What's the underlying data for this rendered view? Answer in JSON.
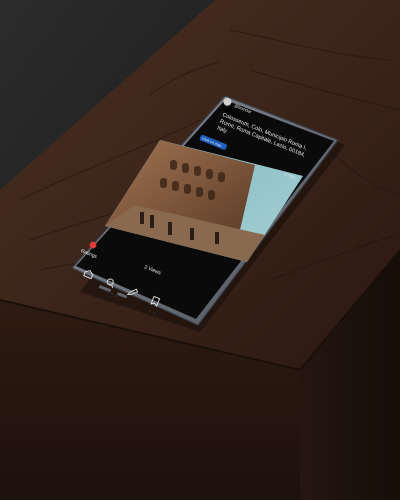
{
  "app": {
    "status_bar": {
      "carrier": ""
    },
    "header": {
      "username": "@brandar",
      "title_line1": "Colosseum, Colo, Municipio Roma I,",
      "title_line2": "Rome, Roma Capitale, Lazio, 00184,",
      "title_line3": "Italy",
      "chip_label": "View on map"
    },
    "photo": {
      "caption": "4 / GN"
    },
    "bottom_bar": {
      "ratings_label": "Ratings",
      "views_label": "2 Views",
      "nav": [
        "home-icon",
        "search-icon",
        "edit-icon",
        "bookmark-icon"
      ]
    },
    "colors": {
      "table_wood": "#3a2418",
      "phone_frame": "#6e737d",
      "screen_bg": "#0a0a0a",
      "accent_red": "#e53935",
      "chip_blue": "#1f5fbf"
    }
  }
}
